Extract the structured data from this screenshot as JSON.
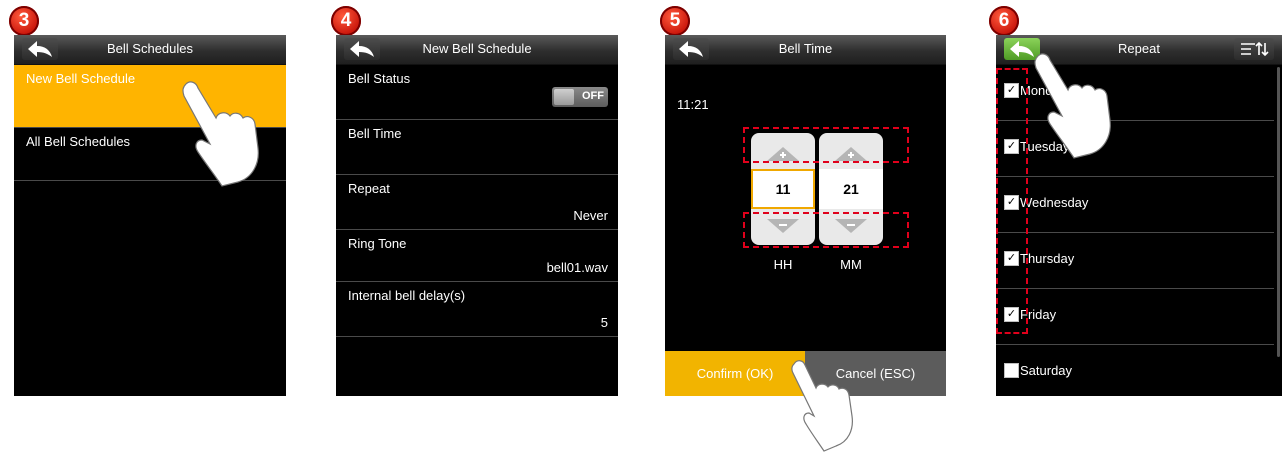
{
  "steps": [
    "3",
    "4",
    "5",
    "6"
  ],
  "panel3": {
    "title": "Bell Schedules",
    "items": [
      "New Bell Schedule",
      "All Bell Schedules"
    ]
  },
  "panel4": {
    "title": "New Bell Schedule",
    "rows": [
      {
        "label": "Bell Status",
        "value": "OFF"
      },
      {
        "label": "Bell Time",
        "value": ""
      },
      {
        "label": "Repeat",
        "value": "Never"
      },
      {
        "label": "Ring Tone",
        "value": "bell01.wav"
      },
      {
        "label": "Internal bell delay(s)",
        "value": "5"
      }
    ]
  },
  "panel5": {
    "title": "Bell Time",
    "time": "11:21",
    "hour": "11",
    "minute": "21",
    "hour_label": "HH",
    "minute_label": "MM",
    "confirm": "Confirm (OK)",
    "cancel": "Cancel (ESC)"
  },
  "panel6": {
    "title": "Repeat",
    "days": [
      {
        "label": "Monday",
        "checked": true
      },
      {
        "label": "Tuesday",
        "checked": true
      },
      {
        "label": "Wednesday",
        "checked": true
      },
      {
        "label": "Thursday",
        "checked": true
      },
      {
        "label": "Friday",
        "checked": true
      },
      {
        "label": "Saturday",
        "checked": false
      }
    ]
  },
  "colors": {
    "highlight": "#ffb400",
    "confirm": "#f2b400",
    "badge": "#d01c0c",
    "dashed": "#e0001b",
    "back_green": "#6bbf3a"
  }
}
